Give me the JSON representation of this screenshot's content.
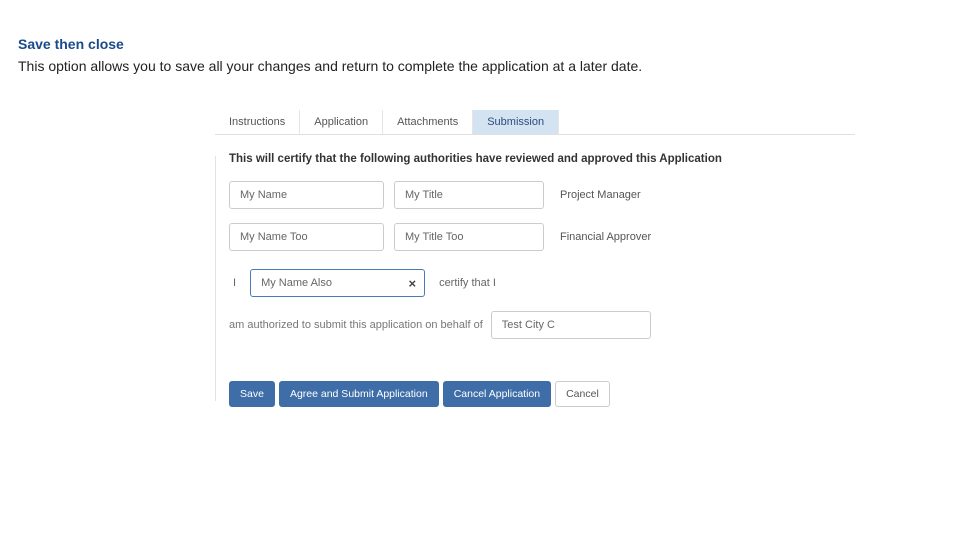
{
  "heading": "Save then close",
  "description": "This option allows you to save all your changes and return to complete the application at a later date.",
  "tabs": {
    "t0": "Instructions",
    "t1": "Application",
    "t2": "Attachments",
    "t3": "Submission"
  },
  "cert_statement": "This will certify that the following authorities have reviewed and approved this Application",
  "row1": {
    "name": "My Name",
    "title": "My Title",
    "role": "Project Manager"
  },
  "row2": {
    "name": "My Name Too",
    "title": "My Title Too",
    "role": "Financial Approver"
  },
  "inline": {
    "pre": "I",
    "name": "My Name Also",
    "post": "certify that I"
  },
  "auth_text": "am authorized to submit this application on behalf of",
  "org_value": "Test City C",
  "buttons": {
    "save": "Save",
    "submit": "Agree and Submit Application",
    "cancel_app": "Cancel Application",
    "cancel": "Cancel"
  }
}
